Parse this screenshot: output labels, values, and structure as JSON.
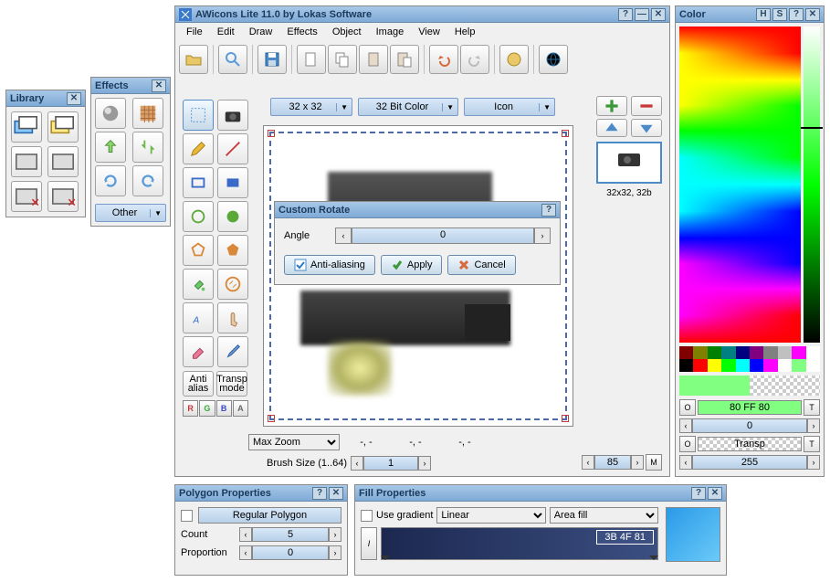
{
  "app": {
    "title": "AWicons Lite 11.0 by Lokas Software"
  },
  "menu": {
    "file": "File",
    "edit": "Edit",
    "draw": "Draw",
    "effects": "Effects",
    "object": "Object",
    "image": "Image",
    "view": "View",
    "help": "Help"
  },
  "dropdowns": {
    "size": "32 x 32",
    "bit": "32 Bit Color",
    "type": "Icon",
    "zoom_label": "Max Zoom"
  },
  "coord": {
    "c1": "-, -",
    "c2": "-, -",
    "c3": "-, -"
  },
  "brush": {
    "label": "Brush Size (1..64)",
    "val": "1",
    "zoom": "85",
    "mode": "M"
  },
  "thumbs": {
    "t1": "32x32, 32b"
  },
  "tools": {
    "anti": "Anti\nalias",
    "transp": "Transp\nmode",
    "r": "R",
    "g": "G",
    "b": "B",
    "a": "A"
  },
  "library": {
    "title": "Library"
  },
  "effects": {
    "title": "Effects",
    "other": "Other"
  },
  "color": {
    "title": "Color",
    "hex": "80 FF 80",
    "transp": "Transp",
    "alpha": "255",
    "o": "O",
    "t": "T",
    "zero": "0"
  },
  "polygon": {
    "title": "Polygon Properties",
    "regular": "Regular Polygon",
    "count_lbl": "Count",
    "count": "5",
    "prop_lbl": "Proportion",
    "prop": "0"
  },
  "fill": {
    "title": "Fill Properties",
    "grad": "Use gradient",
    "linear": "Linear",
    "area": "Area fill",
    "hex": "3B 4F 81",
    "i": "I"
  },
  "dialog": {
    "title": "Custom Rotate",
    "angle_lbl": "Angle",
    "angle": "0",
    "aa": "Anti-aliasing",
    "apply": "Apply",
    "cancel": "Cancel"
  }
}
